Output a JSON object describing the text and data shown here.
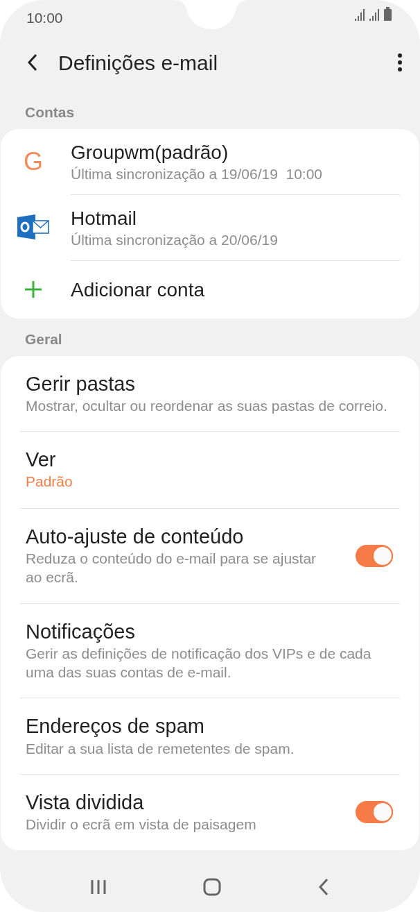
{
  "status_bar": {
    "time": "10:00"
  },
  "header": {
    "title": "Definições e-mail"
  },
  "sections": [
    {
      "title": "Contas",
      "items": [
        {
          "kind": "letter_account",
          "icon_text": "G",
          "title": "Groupwm(padrão)",
          "subtitle": "Última sincronização a 19/06/19  10:00"
        },
        {
          "kind": "mail_account",
          "title": "Hotmail",
          "subtitle": "Última sincronização a 20/06/19"
        },
        {
          "kind": "add",
          "title": "Adicionar conta"
        }
      ]
    },
    {
      "title": "Geral",
      "items": [
        {
          "kind": "plain",
          "title": "Gerir pastas",
          "subtitle": "Mostrar, ocultar ou reordenar as suas pastas de correio."
        },
        {
          "kind": "value",
          "title": "Ver",
          "value": "Padrão"
        },
        {
          "kind": "toggle",
          "title": "Auto-ajuste de conteúdo",
          "subtitle": "Reduza o conteúdo do e-mail para se ajustar ao ecrã.",
          "on": true
        },
        {
          "kind": "plain",
          "title": "Notificações",
          "subtitle": "Gerir as definições de notificação dos VIPs e de cada uma das suas contas de e-mail."
        },
        {
          "kind": "plain",
          "title": "Endereços de spam",
          "subtitle": "Editar a sua lista de remetentes de spam."
        },
        {
          "kind": "toggle",
          "title": "Vista dividida",
          "subtitle": "Dividir o ecrã em vista de paisagem",
          "on": true
        }
      ]
    }
  ]
}
